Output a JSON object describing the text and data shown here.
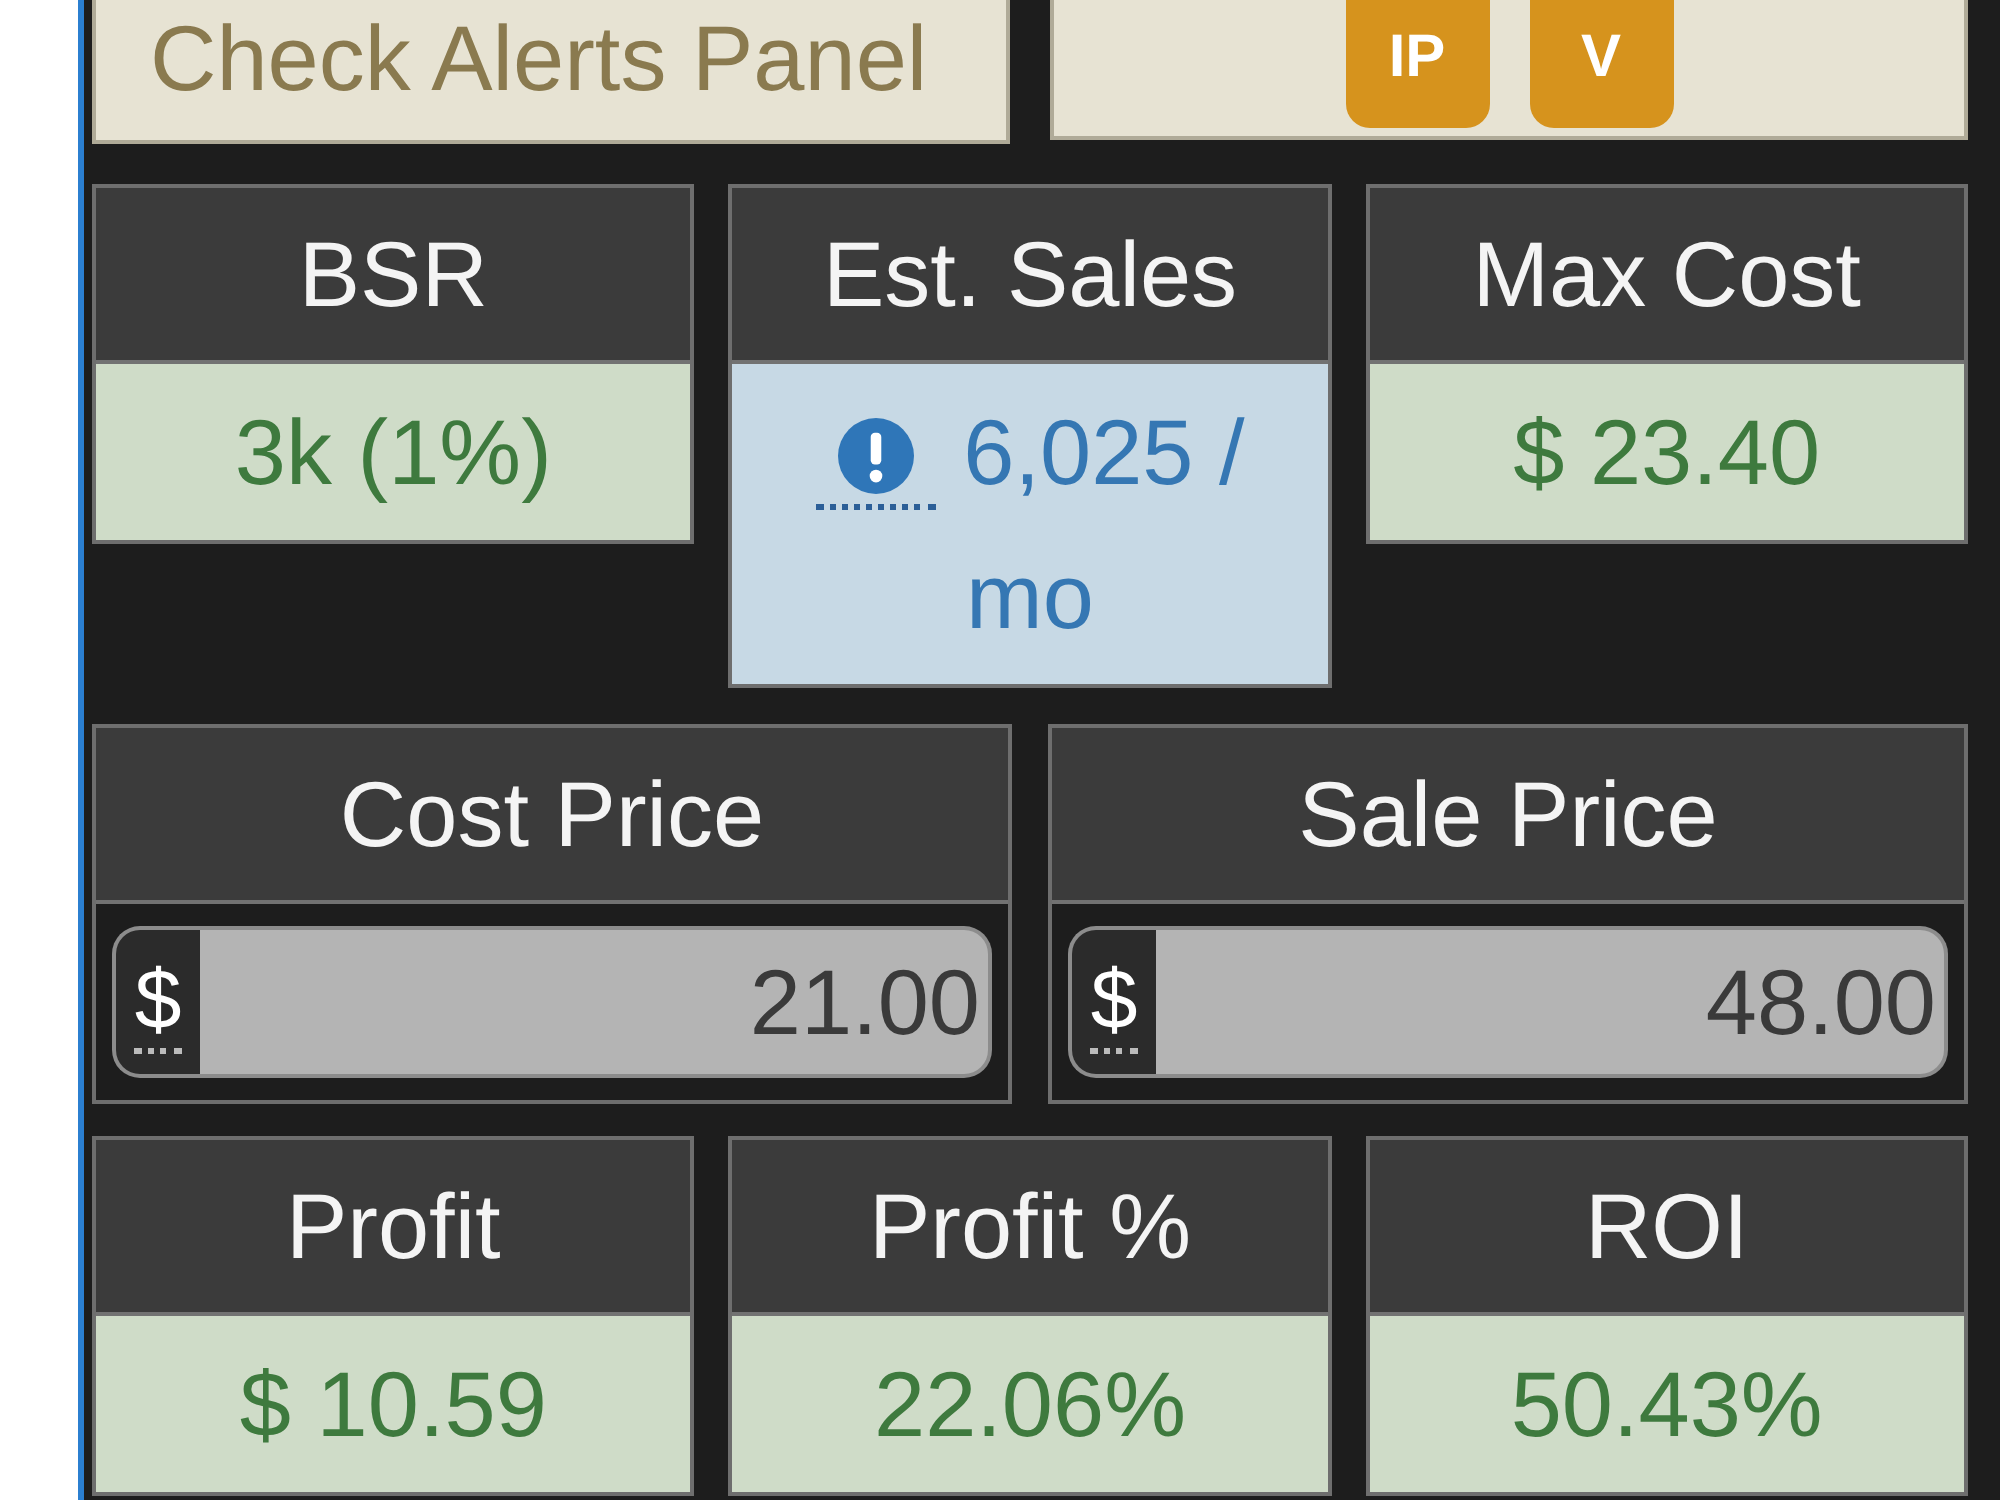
{
  "alerts_button": {
    "label": "Check Alerts Panel"
  },
  "badges": [
    {
      "label": "IP"
    },
    {
      "label": "V"
    }
  ],
  "stats": [
    {
      "label": "BSR",
      "value": "3k (1%)",
      "kind": "plain"
    },
    {
      "label": "Est. Sales",
      "value": "6,025 / mo",
      "kind": "alert"
    },
    {
      "label": "Max Cost",
      "value": "$ 23.40",
      "kind": "plain"
    }
  ],
  "prices": [
    {
      "label": "Cost Price",
      "currency": "$",
      "value": "21.00"
    },
    {
      "label": "Sale Price",
      "currency": "$",
      "value": "48.00"
    }
  ],
  "results": [
    {
      "label": "Profit",
      "value": "$ 10.59"
    },
    {
      "label": "Profit %",
      "value": "22.06%"
    },
    {
      "label": "ROI",
      "value": "50.43%"
    }
  ]
}
